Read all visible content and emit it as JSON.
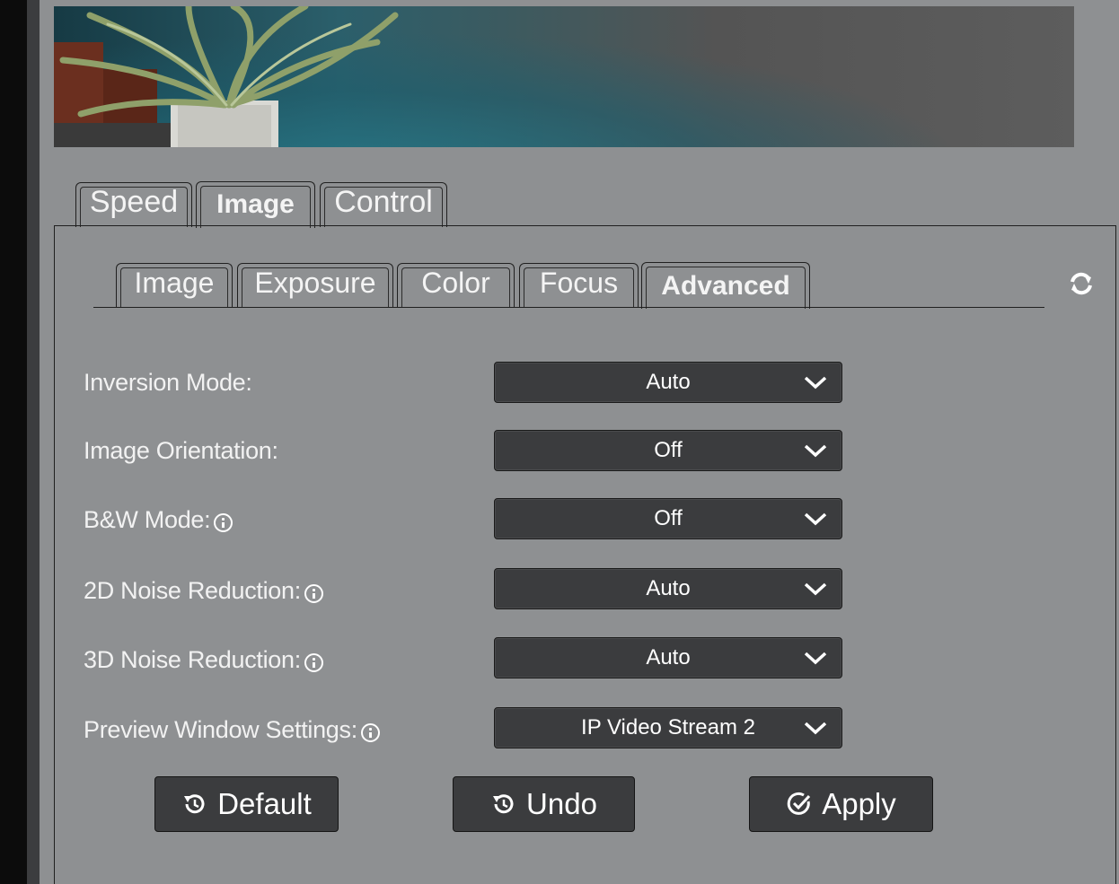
{
  "main_tabs": [
    {
      "label": "Speed",
      "active": false
    },
    {
      "label": "Image",
      "active": true
    },
    {
      "label": "Control",
      "active": false
    }
  ],
  "sub_tabs": [
    {
      "label": "Image",
      "active": false
    },
    {
      "label": "Exposure",
      "active": false
    },
    {
      "label": "Color",
      "active": false
    },
    {
      "label": "Focus",
      "active": false
    },
    {
      "label": "Advanced",
      "active": true
    }
  ],
  "settings": [
    {
      "label": "Inversion Mode:",
      "value": "Auto",
      "info": false
    },
    {
      "label": "Image Orientation:",
      "value": "Off",
      "info": false
    },
    {
      "label": "B&W Mode:",
      "value": "Off",
      "info": true
    },
    {
      "label": "2D Noise Reduction:",
      "value": "Auto",
      "info": true
    },
    {
      "label": "3D Noise Reduction:",
      "value": "Auto",
      "info": true
    },
    {
      "label": "Preview Window Settings:",
      "value": "IP Video Stream 2",
      "info": true
    }
  ],
  "buttons": {
    "default_label": "Default",
    "undo_label": "Undo",
    "apply_label": "Apply"
  },
  "icons": [
    "refresh-icon",
    "chevron-down-icon",
    "info-icon",
    "history-icon",
    "check-circle-icon"
  ],
  "colors": {
    "panel_bg": "#8e9092",
    "control_bg": "#3b3c3e",
    "text": "#ffffff"
  }
}
